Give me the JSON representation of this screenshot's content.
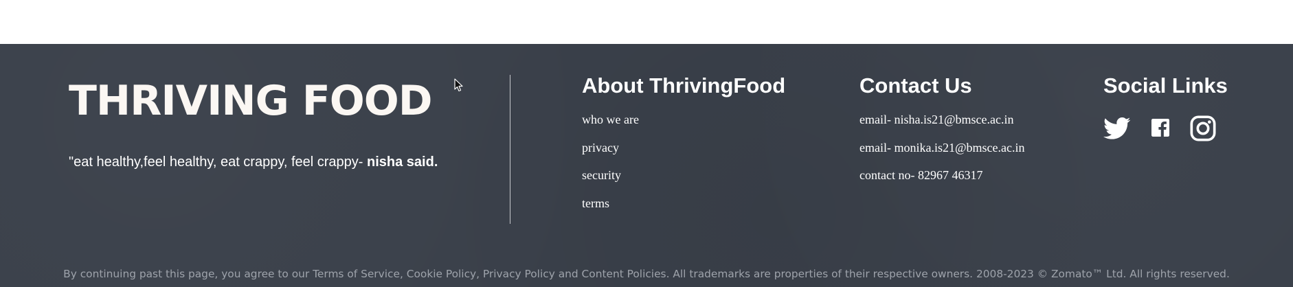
{
  "brand": {
    "logo_text": "THRIVING FOOD",
    "quote_prefix": "\"eat healthy,feel healthy, eat crappy, feel crappy- ",
    "quote_author": "nisha said."
  },
  "about": {
    "heading": "About ThrivingFood",
    "links": [
      "who we are",
      "privacy",
      "security",
      "terms"
    ]
  },
  "contact": {
    "heading": "Contact Us",
    "lines": [
      "email- nisha.is21@bmsce.ac.in",
      "email- monika.is21@bmsce.ac.in",
      "contact no- 82967 46317"
    ]
  },
  "social": {
    "heading": "Social Links",
    "icons": [
      "twitter-icon",
      "facebook-icon",
      "instagram-icon"
    ]
  },
  "legal": {
    "text": "By continuing past this page, you agree to our Terms of Service, Cookie Policy, Privacy Policy and Content Policies. All trademarks are properties of their respective owners. 2008-2023 © Zomato™ Ltd. All rights reserved."
  },
  "colors": {
    "footer_bg": "#3a404a",
    "text": "#ffffff",
    "legal_text": "#9ea3ab"
  }
}
